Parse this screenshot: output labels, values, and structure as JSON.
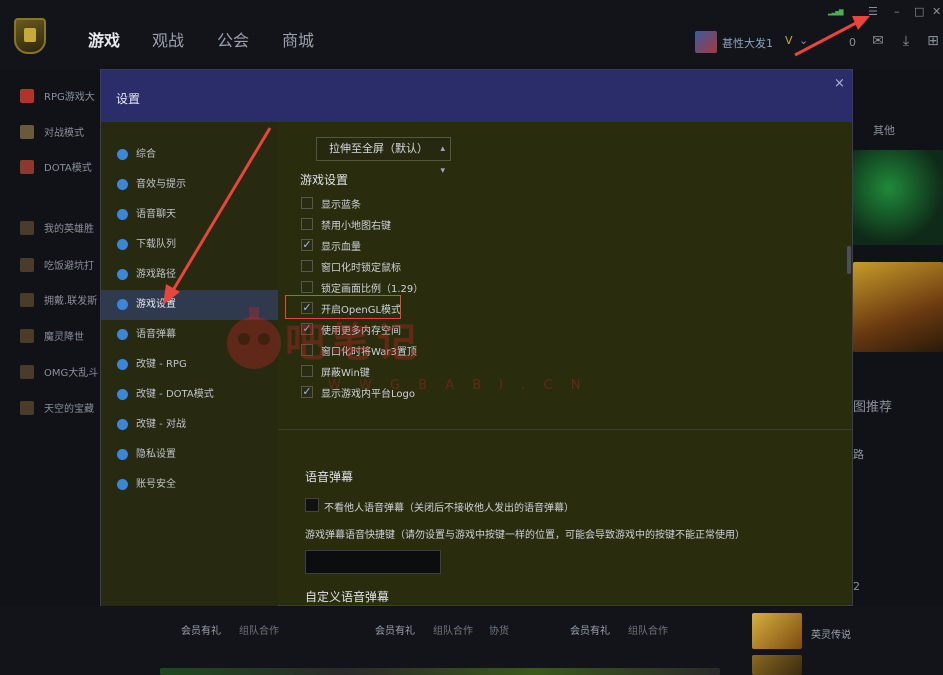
{
  "nav": {
    "items": [
      "游戏",
      "观战",
      "公会",
      "商城"
    ],
    "active": 0
  },
  "user": {
    "name": "甚性大发1",
    "level_badge": "V",
    "message_count": "0"
  },
  "bg_left_list": [
    "RPG游戏大",
    "对战模式",
    "DOTA模式",
    "我的英雄胜",
    "吃饭避坑打",
    "拥戴.联发斯",
    "魔灵降世",
    "OMG大乱斗",
    "天空的宝藏"
  ],
  "bg_right": {
    "other": "其他",
    "recommend": "图推荐",
    "route": "路",
    "number": "2",
    "game_title": "英灵传说"
  },
  "bottom_links": [
    "会员有礼",
    "组队合作",
    "会员有礼",
    "组队合作",
    "协货",
    "会员有礼",
    "组队合作"
  ],
  "dialog": {
    "title": "设置",
    "close_label": "×",
    "sidebar": [
      {
        "label": "综合",
        "icon": "pie-chart-icon"
      },
      {
        "label": "音效与提示",
        "icon": "bell-icon"
      },
      {
        "label": "语音聊天",
        "icon": "microphone-icon"
      },
      {
        "label": "下载队列",
        "icon": "cloud-download-icon"
      },
      {
        "label": "游戏路径",
        "icon": "gamepad-icon"
      },
      {
        "label": "游戏设置",
        "icon": "gear-icon"
      },
      {
        "label": "语音弹幕",
        "icon": "speech-icon"
      },
      {
        "label": "改键 - RPG",
        "icon": "key-icon"
      },
      {
        "label": "改键 - DOTA模式",
        "icon": "key-icon"
      },
      {
        "label": "改键 - 对战",
        "icon": "key-icon"
      },
      {
        "label": "隐私设置",
        "icon": "lock-icon"
      },
      {
        "label": "账号安全",
        "icon": "shield-icon"
      }
    ],
    "active_sidebar": 5,
    "display_select": {
      "value": "拉伸至全屏（默认）"
    },
    "game_settings": {
      "title": "游戏设置",
      "options": [
        {
          "label": "显示蓝条",
          "checked": false
        },
        {
          "label": "禁用小地图右键",
          "checked": false
        },
        {
          "label": "显示血量",
          "checked": true
        },
        {
          "label": "窗口化时锁定鼠标",
          "checked": false
        },
        {
          "label": "锁定画面比例（1.29）",
          "checked": false
        },
        {
          "label": "开启OpenGL模式",
          "checked": true
        },
        {
          "label": "使用更多内存空间",
          "checked": true
        },
        {
          "label": "窗口化时将War3置顶",
          "checked": false
        },
        {
          "label": "屏蔽Win键",
          "checked": false
        },
        {
          "label": "显示游戏内平台Logo",
          "checked": true
        }
      ]
    },
    "voice_barrage": {
      "title": "语音弹幕",
      "hide_others_label": "不看他人语音弹幕（关闭后不接收他人发出的语音弹幕）",
      "hotkey_label": "游戏弹幕语音快捷键（请勿设置与游戏中按键一样的位置，可能会导致游戏中的按键不能正常使用）",
      "custom_title": "自定义语音弹幕"
    }
  },
  "watermark": {
    "main": "吧笔记",
    "sub": "W W G B A B I . C N"
  },
  "colors": {
    "highlight_box": "#e8453c",
    "arrow": "#e8453c",
    "accent_blue": "#3b86d8",
    "dialog_header": "#2a2d6a"
  }
}
